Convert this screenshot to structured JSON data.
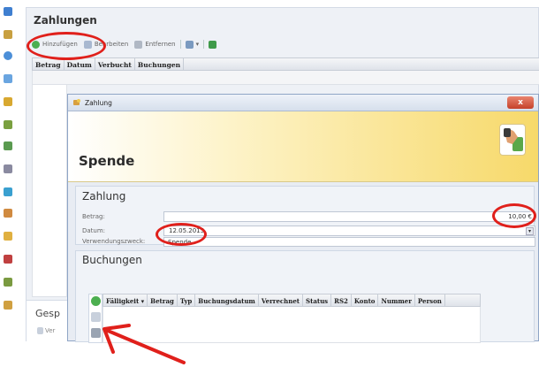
{
  "colors": {
    "annotation": "#e0201b",
    "banner_start": "#ffffff",
    "banner_end": "#f7d96a",
    "dialog_bg": "#e8ecf3",
    "close_button": "#d2553e"
  },
  "left_bar": {
    "icons": [
      "contacts-icon",
      "person-icon",
      "globe-icon",
      "calendar-icon",
      "edit-icon",
      "group-icon",
      "list-icon",
      "tool-icon",
      "pin-icon",
      "chart-icon",
      "money-icon",
      "tree-icon",
      "map-icon",
      "folder-icon"
    ]
  },
  "background": {
    "title": "Zahlungen",
    "toolbar": {
      "add_label": "Hinzufügen",
      "edit_label": "Bearbeiten",
      "remove_label": "Entfernen"
    },
    "grid_columns": [
      "Betrag",
      "Datum",
      "Verbucht",
      "Buchungen"
    ],
    "lower_title": "Gesp",
    "lower_button": "Ver"
  },
  "dialog": {
    "title": "Zahlung",
    "close_label": "x",
    "banner_title": "Spende",
    "zahlung_section": {
      "title": "Zahlung",
      "betrag_label": "Betrag:",
      "betrag_value": "10,00 €",
      "datum_label": "Datum:",
      "datum_value": "12.05.2015",
      "zweck_label": "Verwendungszweck:",
      "zweck_value": "Spende"
    },
    "buchungen_section": {
      "title": "Buchungen",
      "columns": [
        "Fälligkeit ▾",
        "Betrag",
        "Typ",
        "Buchungsdatum",
        "Verrechnet",
        "Status",
        "RS2",
        "Konto",
        "Nummer",
        "Person"
      ]
    }
  }
}
